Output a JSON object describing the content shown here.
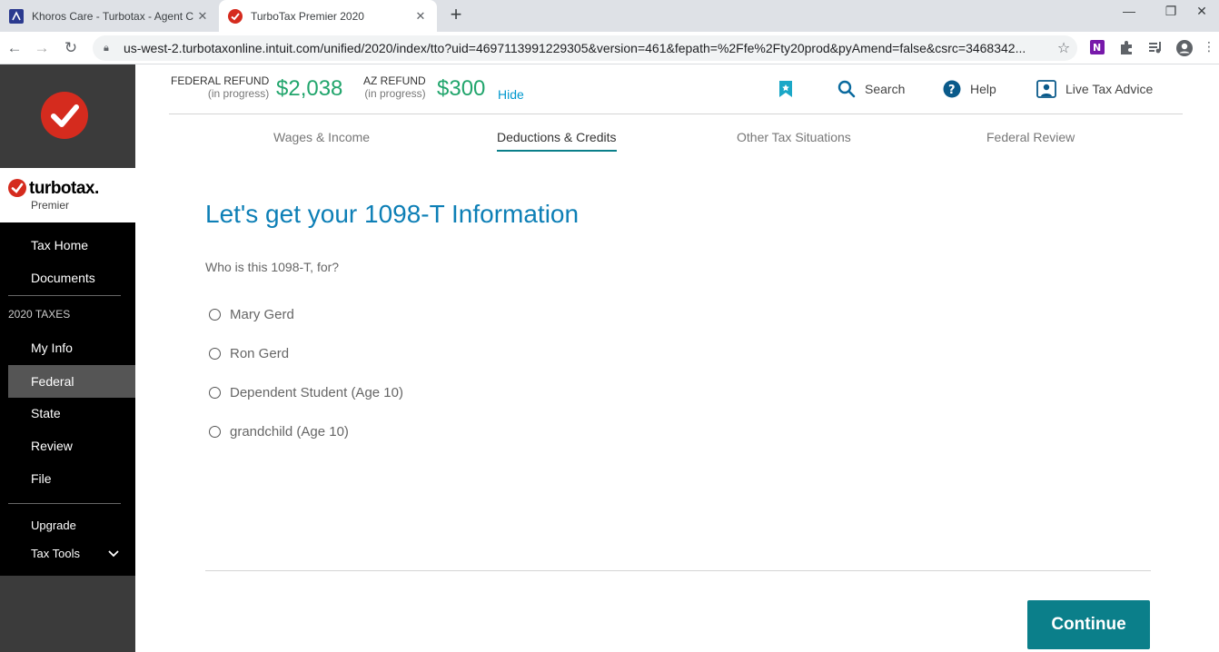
{
  "browser": {
    "tabs": [
      {
        "title": "Khoros Care - Turbotax - Agent C",
        "close": "✕"
      },
      {
        "title": "TurboTax Premier 2020",
        "close": "✕"
      }
    ],
    "new_tab": "+",
    "window_controls": {
      "minimize": "—",
      "restore": "❐",
      "close": "✕"
    },
    "url": "us-west-2.turbotaxonline.intuit.com/unified/2020/index/tto?uid=4697113991229305&version=461&fepath=%2Ffe%2Fty20prod&pyAmend=false&csrc=3468342..."
  },
  "sidebar": {
    "brand_name": "turbotax.",
    "brand_tier": "Premier",
    "items_top": [
      {
        "label": "Tax Home"
      },
      {
        "label": "Documents"
      }
    ],
    "section_heading": "2020 TAXES",
    "items_taxes": [
      {
        "label": "My Info"
      },
      {
        "label": "Federal"
      },
      {
        "label": "State"
      },
      {
        "label": "Review"
      },
      {
        "label": "File"
      }
    ],
    "active_item": "Federal",
    "upgrade": "Upgrade",
    "tax_tools": "Tax Tools"
  },
  "header": {
    "federal": {
      "label": "FEDERAL REFUND",
      "status": "(in progress)",
      "amount": "$2,038"
    },
    "state": {
      "label": "AZ REFUND",
      "status": "(in progress)",
      "amount": "$300"
    },
    "hide": "Hide",
    "tools": {
      "search": "Search",
      "help": "Help",
      "live_advice": "Live Tax Advice"
    }
  },
  "steps": [
    {
      "label": "Wages & Income"
    },
    {
      "label": "Deductions & Credits"
    },
    {
      "label": "Other Tax Situations"
    },
    {
      "label": "Federal Review"
    }
  ],
  "current_step": "Deductions & Credits",
  "main": {
    "title": "Let's get your 1098-T Information",
    "question": "Who is this 1098-T, for?",
    "options": [
      {
        "label": "Mary Gerd",
        "selected": false
      },
      {
        "label": "Ron Gerd",
        "selected": false
      },
      {
        "label": "Dependent Student (Age 10)",
        "selected": false
      },
      {
        "label": "grandchild (Age 10)",
        "selected": false
      }
    ],
    "continue": "Continue"
  },
  "colors": {
    "brand_red": "#d52b1e",
    "refund_green": "#21a56c",
    "title_blue": "#0d7fb6",
    "button_teal": "#0b7f8a",
    "link_blue": "#0098ce"
  }
}
